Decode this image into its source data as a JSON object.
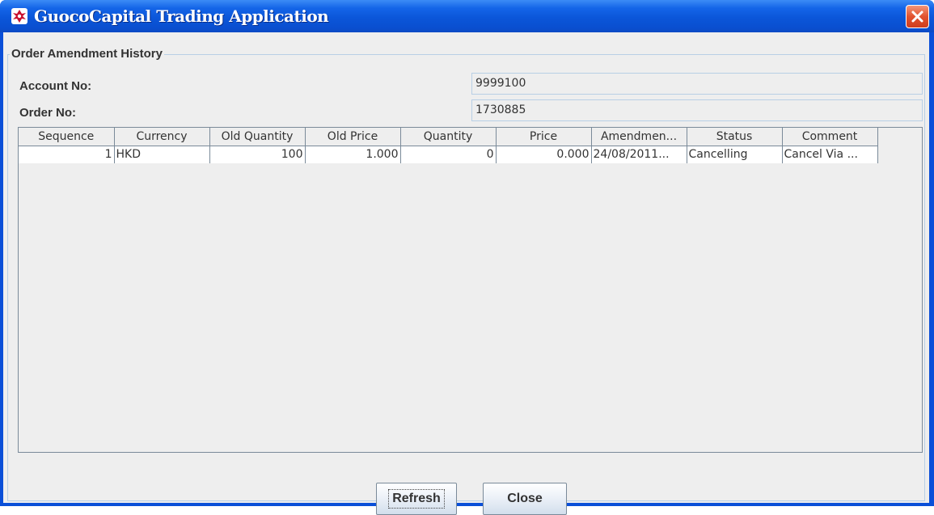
{
  "window": {
    "title": "GuocoCapital Trading Application",
    "icon": "guococapital-logo-icon",
    "close_icon": "close-icon",
    "accent_color": "#0a4fd8",
    "close_color": "#e2532f"
  },
  "group": {
    "title": "Order Amendment History"
  },
  "info": {
    "account_label": "Account No:",
    "account_value": "9999100",
    "order_label": "Order No:",
    "order_value": "1730885"
  },
  "table": {
    "columns": [
      "Sequence",
      "Currency",
      "Old Quantity",
      "Old Price",
      "Quantity",
      "Price",
      "Amendmen...",
      "Status",
      "Comment"
    ],
    "rows": [
      [
        "1",
        "HKD",
        "100",
        "1.000",
        "0",
        "0.000",
        "24/08/2011...",
        "Cancelling",
        "Cancel Via ..."
      ]
    ]
  },
  "buttons": {
    "refresh": "Refresh",
    "close": "Close"
  }
}
